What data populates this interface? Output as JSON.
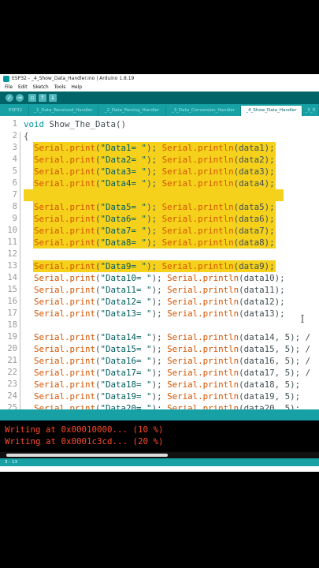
{
  "window": {
    "title": "ESP32 - _4_Show_Data_Handler.ino | Arduino 1.8.19"
  },
  "menu": [
    "File",
    "Edit",
    "Sketch",
    "Tools",
    "Help"
  ],
  "toolbar": {
    "buttons": [
      "verify-icon",
      "upload-icon",
      "new-icon",
      "open-icon",
      "save-icon"
    ],
    "accent": "#006468"
  },
  "tabs": [
    {
      "label": "ESP32",
      "active": false
    },
    {
      "label": "_1_Data_Received_Handler",
      "active": false
    },
    {
      "label": "_2_Data_Parsing_Handler",
      "active": false
    },
    {
      "label": "_3_Data_Conversion_Handler",
      "active": false
    },
    {
      "label": "_4_Show_Data_Handler",
      "active": true
    },
    {
      "label": "_5_R",
      "active": false
    }
  ],
  "editor": {
    "highlight_color": "#f5d11c",
    "lines": [
      {
        "n": "1",
        "hl": false,
        "tokens": [
          [
            "kw",
            "void"
          ],
          [
            "p",
            " Show_The_Data()"
          ]
        ]
      },
      {
        "n": "2",
        "hl": false,
        "tokens": [
          [
            "p",
            "{"
          ]
        ]
      },
      {
        "n": "3",
        "hl": true,
        "tokens": [
          [
            "p",
            "  "
          ],
          [
            "fn",
            "Serial.print"
          ],
          [
            "p",
            "("
          ],
          [
            "str",
            "\"Data1= \""
          ],
          [
            "p",
            "); "
          ],
          [
            "fn",
            "Serial.println"
          ],
          [
            "p",
            "(data1);"
          ]
        ]
      },
      {
        "n": "4",
        "hl": true,
        "tokens": [
          [
            "p",
            "  "
          ],
          [
            "fn",
            "Serial.print"
          ],
          [
            "p",
            "("
          ],
          [
            "str",
            "\"Data2= \""
          ],
          [
            "p",
            "); "
          ],
          [
            "fn",
            "Serial.println"
          ],
          [
            "p",
            "(data2);"
          ]
        ]
      },
      {
        "n": "5",
        "hl": true,
        "tokens": [
          [
            "p",
            "  "
          ],
          [
            "fn",
            "Serial.print"
          ],
          [
            "p",
            "("
          ],
          [
            "str",
            "\"Data3= \""
          ],
          [
            "p",
            "); "
          ],
          [
            "fn",
            "Serial.println"
          ],
          [
            "p",
            "(data3);"
          ]
        ]
      },
      {
        "n": "6",
        "hl": true,
        "tokens": [
          [
            "p",
            "  "
          ],
          [
            "fn",
            "Serial.print"
          ],
          [
            "p",
            "("
          ],
          [
            "str",
            "\"Data4= \""
          ],
          [
            "p",
            "); "
          ],
          [
            "fn",
            "Serial.println"
          ],
          [
            "p",
            "(data4);"
          ]
        ]
      },
      {
        "n": "7",
        "hl": true,
        "tokens": [
          [
            "p",
            ""
          ]
        ]
      },
      {
        "n": "8",
        "hl": true,
        "tokens": [
          [
            "p",
            "  "
          ],
          [
            "fn",
            "Serial.print"
          ],
          [
            "p",
            "("
          ],
          [
            "str",
            "\"Data5= \""
          ],
          [
            "p",
            "); "
          ],
          [
            "fn",
            "Serial.println"
          ],
          [
            "p",
            "(data5);"
          ]
        ]
      },
      {
        "n": "9",
        "hl": true,
        "tokens": [
          [
            "p",
            "  "
          ],
          [
            "fn",
            "Serial.print"
          ],
          [
            "p",
            "("
          ],
          [
            "str",
            "\"Data6= \""
          ],
          [
            "p",
            "); "
          ],
          [
            "fn",
            "Serial.println"
          ],
          [
            "p",
            "(data6);"
          ]
        ]
      },
      {
        "n": "10",
        "hl": true,
        "tokens": [
          [
            "p",
            "  "
          ],
          [
            "fn",
            "Serial.print"
          ],
          [
            "p",
            "("
          ],
          [
            "str",
            "\"Data7= \""
          ],
          [
            "p",
            "); "
          ],
          [
            "fn",
            "Serial.println"
          ],
          [
            "p",
            "(data7);"
          ]
        ]
      },
      {
        "n": "11",
        "hl": true,
        "tokens": [
          [
            "p",
            "  "
          ],
          [
            "fn",
            "Serial.print"
          ],
          [
            "p",
            "("
          ],
          [
            "str",
            "\"Data8= \""
          ],
          [
            "p",
            "); "
          ],
          [
            "fn",
            "Serial.println"
          ],
          [
            "p",
            "(data8);"
          ]
        ]
      },
      {
        "n": "12",
        "hl": false,
        "tokens": [
          [
            "p",
            ""
          ]
        ]
      },
      {
        "n": "13",
        "hl": true,
        "tokens": [
          [
            "p",
            "  "
          ],
          [
            "fn",
            "Serial.print"
          ],
          [
            "p",
            "("
          ],
          [
            "str",
            "\"Data9= \""
          ],
          [
            "p",
            "); "
          ],
          [
            "fn",
            "Serial.println"
          ],
          [
            "p",
            "(data9);"
          ]
        ]
      },
      {
        "n": "14",
        "hl": false,
        "tokens": [
          [
            "p",
            "  "
          ],
          [
            "fn",
            "Serial.print"
          ],
          [
            "p",
            "("
          ],
          [
            "str",
            "\"Data10= \""
          ],
          [
            "p",
            "); "
          ],
          [
            "fn",
            "Serial.println"
          ],
          [
            "p",
            "(data10);"
          ]
        ]
      },
      {
        "n": "15",
        "hl": false,
        "tokens": [
          [
            "p",
            "  "
          ],
          [
            "fn",
            "Serial.print"
          ],
          [
            "p",
            "("
          ],
          [
            "str",
            "\"Data11= \""
          ],
          [
            "p",
            "); "
          ],
          [
            "fn",
            "Serial.println"
          ],
          [
            "p",
            "(data11);"
          ]
        ]
      },
      {
        "n": "16",
        "hl": false,
        "tokens": [
          [
            "p",
            "  "
          ],
          [
            "fn",
            "Serial.print"
          ],
          [
            "p",
            "("
          ],
          [
            "str",
            "\"Data12= \""
          ],
          [
            "p",
            "); "
          ],
          [
            "fn",
            "Serial.println"
          ],
          [
            "p",
            "(data12);"
          ]
        ]
      },
      {
        "n": "17",
        "hl": false,
        "tokens": [
          [
            "p",
            "  "
          ],
          [
            "fn",
            "Serial.print"
          ],
          [
            "p",
            "("
          ],
          [
            "str",
            "\"Data13= \""
          ],
          [
            "p",
            "); "
          ],
          [
            "fn",
            "Serial.println"
          ],
          [
            "p",
            "(data13);"
          ]
        ]
      },
      {
        "n": "18",
        "hl": false,
        "tokens": [
          [
            "p",
            ""
          ]
        ]
      },
      {
        "n": "19",
        "hl": false,
        "tokens": [
          [
            "p",
            "  "
          ],
          [
            "fn",
            "Serial.print"
          ],
          [
            "p",
            "("
          ],
          [
            "str",
            "\"Data14= \""
          ],
          [
            "p",
            "); "
          ],
          [
            "fn",
            "Serial.println"
          ],
          [
            "p",
            "(data14, 5); /"
          ]
        ]
      },
      {
        "n": "20",
        "hl": false,
        "tokens": [
          [
            "p",
            "  "
          ],
          [
            "fn",
            "Serial.print"
          ],
          [
            "p",
            "("
          ],
          [
            "str",
            "\"Data15= \""
          ],
          [
            "p",
            "); "
          ],
          [
            "fn",
            "Serial.println"
          ],
          [
            "p",
            "(data15, 5); /"
          ]
        ]
      },
      {
        "n": "21",
        "hl": false,
        "tokens": [
          [
            "p",
            "  "
          ],
          [
            "fn",
            "Serial.print"
          ],
          [
            "p",
            "("
          ],
          [
            "str",
            "\"Data16= \""
          ],
          [
            "p",
            "); "
          ],
          [
            "fn",
            "Serial.println"
          ],
          [
            "p",
            "(data16, 5); /"
          ]
        ]
      },
      {
        "n": "22",
        "hl": false,
        "tokens": [
          [
            "p",
            "  "
          ],
          [
            "fn",
            "Serial.print"
          ],
          [
            "p",
            "("
          ],
          [
            "str",
            "\"Data17= \""
          ],
          [
            "p",
            "); "
          ],
          [
            "fn",
            "Serial.println"
          ],
          [
            "p",
            "(data17, 5); /"
          ]
        ]
      },
      {
        "n": "23",
        "hl": false,
        "tokens": [
          [
            "p",
            "  "
          ],
          [
            "fn",
            "Serial.print"
          ],
          [
            "p",
            "("
          ],
          [
            "str",
            "\"Data18= \""
          ],
          [
            "p",
            "); "
          ],
          [
            "fn",
            "Serial.println"
          ],
          [
            "p",
            "(data18, 5);"
          ]
        ]
      },
      {
        "n": "24",
        "hl": false,
        "tokens": [
          [
            "p",
            "  "
          ],
          [
            "fn",
            "Serial.print"
          ],
          [
            "p",
            "("
          ],
          [
            "str",
            "\"Data19= \""
          ],
          [
            "p",
            "); "
          ],
          [
            "fn",
            "Serial.println"
          ],
          [
            "p",
            "(data19, 5);"
          ]
        ]
      },
      {
        "n": "25",
        "hl": false,
        "tokens": [
          [
            "p",
            "  "
          ],
          [
            "fn",
            "Serial.print"
          ],
          [
            "p",
            "("
          ],
          [
            "str",
            "\"Data20= \""
          ],
          [
            "p",
            "); "
          ],
          [
            "fn",
            "Serial.println"
          ],
          [
            "p",
            "(data20, 5);"
          ]
        ]
      }
    ]
  },
  "console": {
    "lines": [
      "Writing at 0x00010000... (10 %)",
      "Writing at 0x0001c3cd... (20 %)"
    ],
    "text_color": "#ff4a2a"
  },
  "status": {
    "position": "3 - 13"
  }
}
